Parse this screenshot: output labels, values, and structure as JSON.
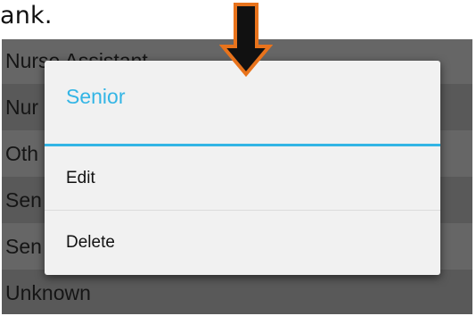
{
  "caption": {
    "text": "ank."
  },
  "background_list": {
    "items": [
      {
        "label": "Nurse Assistant"
      },
      {
        "label": "Nur"
      },
      {
        "label": "Oth"
      },
      {
        "label": "Sen"
      },
      {
        "label": "Sen"
      },
      {
        "label": "Unknown"
      }
    ]
  },
  "dialog": {
    "title": "Senior",
    "items": [
      {
        "label": "Edit"
      },
      {
        "label": "Delete"
      }
    ]
  },
  "colors": {
    "accent": "#33b5e5",
    "arrow_fill": "#111111",
    "arrow_outline": "#e8731c",
    "dialog_bg": "#f1f1f1",
    "list_dark": "#595959",
    "list_light": "#666666"
  },
  "icons": {
    "annotation": "down-arrow-icon"
  }
}
